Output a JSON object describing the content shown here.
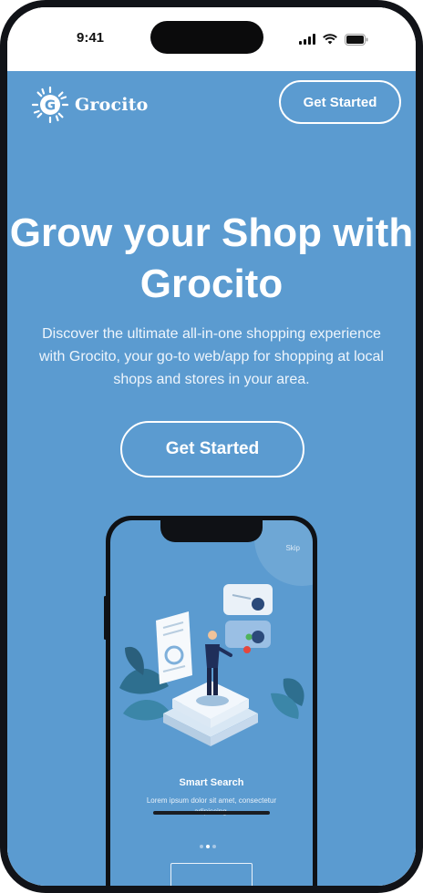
{
  "status_bar": {
    "time": "9:41",
    "icons": [
      "signal-icon",
      "wifi-icon",
      "battery-icon"
    ]
  },
  "header": {
    "logo_text": "Grocito",
    "cta_label": "Get Started"
  },
  "hero": {
    "title": "Grow your Shop with Grocito",
    "subtitle": "Discover the ultimate all-in-one shopping experience with Grocito, your go-to web/app for shopping at local shops and stores in your area.",
    "cta_label": "Get Started"
  },
  "preview": {
    "skip_label": "Skip",
    "feature_title": "Smart Search",
    "feature_desc": "Lorem ipsum dolor sit amet, consectetur adipiscing,",
    "page_dots": 3,
    "active_dot": 2
  },
  "colors": {
    "background": "#5b9bd0",
    "text": "#ffffff",
    "device_frame": "#111318"
  }
}
